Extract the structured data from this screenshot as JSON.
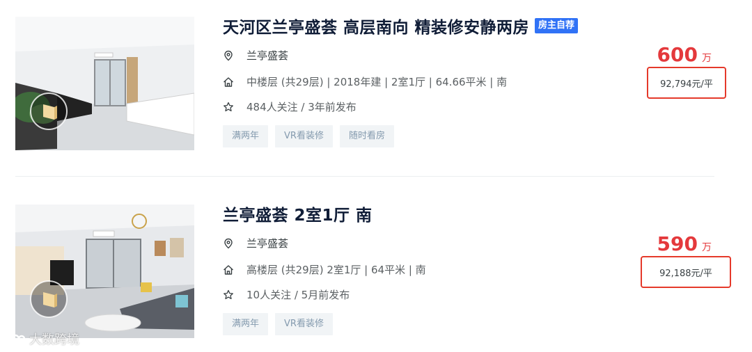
{
  "listings": [
    {
      "title": "天河区兰亭盛荟 高层南向 精装修安静两房",
      "owner_tag": "房主自荐",
      "community": "兰亭盛荟",
      "house_info": "中楼层 (共29层) | 2018年建 | 2室1厅 | 64.66平米 | 南",
      "follow_info": "484人关注 / 3年前发布",
      "tags": [
        "满两年",
        "VR看装修",
        "随时看房"
      ],
      "total_price": "600",
      "price_unit": "万",
      "unit_price": "92,794元/平"
    },
    {
      "title": "兰亭盛荟 2室1厅 南",
      "owner_tag": "",
      "community": "兰亭盛荟",
      "house_info": "高楼层 (共29层) 2室1厅 | 64平米 | 南",
      "follow_info": "10人关注 / 5月前发布",
      "tags": [
        "满两年",
        "VR看装修"
      ],
      "total_price": "590",
      "price_unit": "万",
      "unit_price": "92,188元/平"
    }
  ],
  "watermark": "大数跨境",
  "colors": {
    "title": "#101d37",
    "accent_blue": "#3072f6",
    "price_red": "#e4393c",
    "highlight_box": "#e5392a",
    "tag_bg": "#f1f4f6",
    "tag_text": "#849aae"
  }
}
